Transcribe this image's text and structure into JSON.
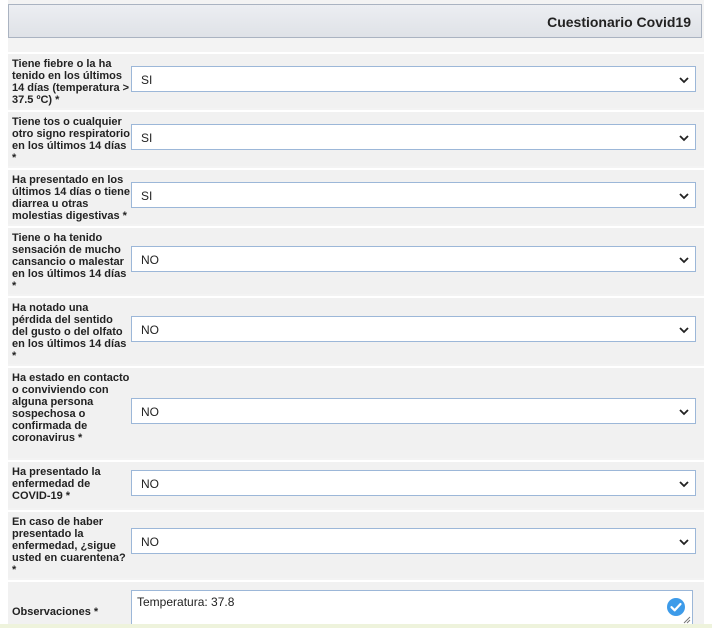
{
  "header": {
    "title": "Cuestionario Covid19"
  },
  "questions": [
    {
      "label": "Tiene fiebre o la ha tenido en los últimos 14 días (temperatura > 37.5 ºC) *",
      "value": "SI"
    },
    {
      "label": "Tiene tos o cualquier otro signo respiratorio en los últimos 14 días *",
      "value": "SI"
    },
    {
      "label": "Ha presentado en los últimos 14 días o tiene diarrea u otras molestias digestivas *",
      "value": "SI"
    },
    {
      "label": "Tiene o ha tenido sensación de mucho cansancio o malestar en los últimos 14 días *",
      "value": "NO"
    },
    {
      "label": "Ha notado una pérdida del sentido del gusto o del olfato en los últimos 14 días *",
      "value": "NO"
    },
    {
      "label": "Ha estado en contacto o conviviendo con alguna persona sospechosa o confirmada de coronavirus *",
      "value": "NO"
    },
    {
      "label": "Ha presentado la enfermedad de COVID-19 *",
      "value": "NO"
    },
    {
      "label": "En caso de haber presentado la enfermedad, ¿sigue usted en cuarentena? *",
      "value": "NO"
    }
  ],
  "observations": {
    "label": "Observaciones *",
    "value": "Temperatura: 37.8"
  },
  "icons": {
    "dropdown": "chevron-down-icon",
    "validated": "check-circle-icon",
    "resize": "resize-grip-icon"
  },
  "colors": {
    "select_border": "#9cb7d8",
    "check_badge": "#3d9be9"
  }
}
